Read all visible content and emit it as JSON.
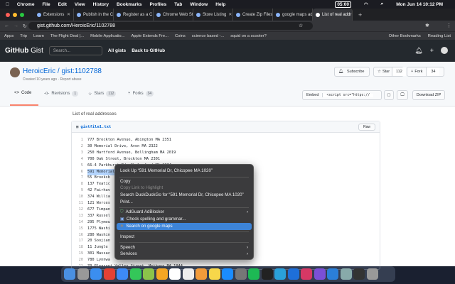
{
  "menubar": {
    "items": [
      "Chrome",
      "File",
      "Edit",
      "View",
      "History",
      "Bookmarks",
      "Profiles",
      "Tab",
      "Window",
      "Help"
    ],
    "clock": "Mon Jun 14  10:12 PM",
    "timer": "05:00"
  },
  "tabs": [
    {
      "label": "Extensions"
    },
    {
      "label": "Publish in the C"
    },
    {
      "label": "Register as a C"
    },
    {
      "label": "Chrome Web St"
    },
    {
      "label": "Store Listing"
    },
    {
      "label": "Create Zip Files"
    },
    {
      "label": "google maps ad"
    },
    {
      "label": "List of real addr",
      "active": true
    }
  ],
  "address": {
    "url": "gist.github.com/HeroicEric/1102788"
  },
  "bookmarks": {
    "items": [
      "Apps",
      "Trip",
      "Learn",
      "The Flight Deal |...",
      "Mobile Applicatio...",
      "Apple Extends Fre...",
      "Coins",
      "science based -...",
      "squid on a scooter?"
    ],
    "other": "Other Bookmarks",
    "reading": "Reading List"
  },
  "github": {
    "logo": "GitHub",
    "logo_suffix": "Gist",
    "search_placeholder": "Search...",
    "links": [
      "All gists",
      "Back to GitHub"
    ]
  },
  "gist": {
    "title": "HeroicEric / gist:1102788",
    "created": "Created 10 years ago · Report abuse",
    "subscribe": "Subscribe",
    "star": "Star",
    "star_count": "112",
    "fork": "Fork",
    "fork_count": "34",
    "tabs": [
      {
        "label": "Code"
      },
      {
        "label": "Revisions",
        "count": "1"
      },
      {
        "label": "Stars",
        "count": "112"
      },
      {
        "label": "Forks",
        "count": "34"
      }
    ],
    "embed": "Embed",
    "embed_value": "<script src=\"https://",
    "download": "Download ZIP"
  },
  "file": {
    "description": "List of real addresses",
    "name": "gistfile1.txt",
    "raw": "Raw",
    "lines": [
      "777 Brockton Avenue, Abington MA 2351",
      "30 Memorial Drive, Avon MA 2322",
      "250 Hartford Avenue, Bellingham MA 2019",
      "700 Oak Street, Brockton MA 2301",
      "66-4 Parkhurst Rd, Chelmsford MA 1824",
      "591 Memorial Dr, Chicopee MA 1020",
      "55 Brooksb",
      "137 Teatic",
      "42 Fairhav",
      "374 Willia",
      "121 Worces",
      "677 Timpan",
      "337 Russel",
      "295 Plymou",
      "1775 Washi",
      "280 Washin",
      "20 Soojian",
      "11 Jungle",
      "301 Massac",
      "780 Lynnwa",
      "70 Pleasant Valley Street, Methuen MA 1844"
    ],
    "selected_line": 6
  },
  "context_menu": {
    "lookup": "Look Up “591 Memorial Dr, Chicopee MA 1020”",
    "copy": "Copy",
    "copy_link": "Copy Link to Highlight",
    "search_ddg": "Search DuckDuckGo for “591 Memorial Dr, Chicopee MA 1020”",
    "print": "Print...",
    "adguard": "AdGuard AdBlocker",
    "spelling": "Check spelling and grammar...",
    "google_maps": "Search on google maps",
    "inspect": "Inspect",
    "speech": "Speech",
    "services": "Services"
  }
}
